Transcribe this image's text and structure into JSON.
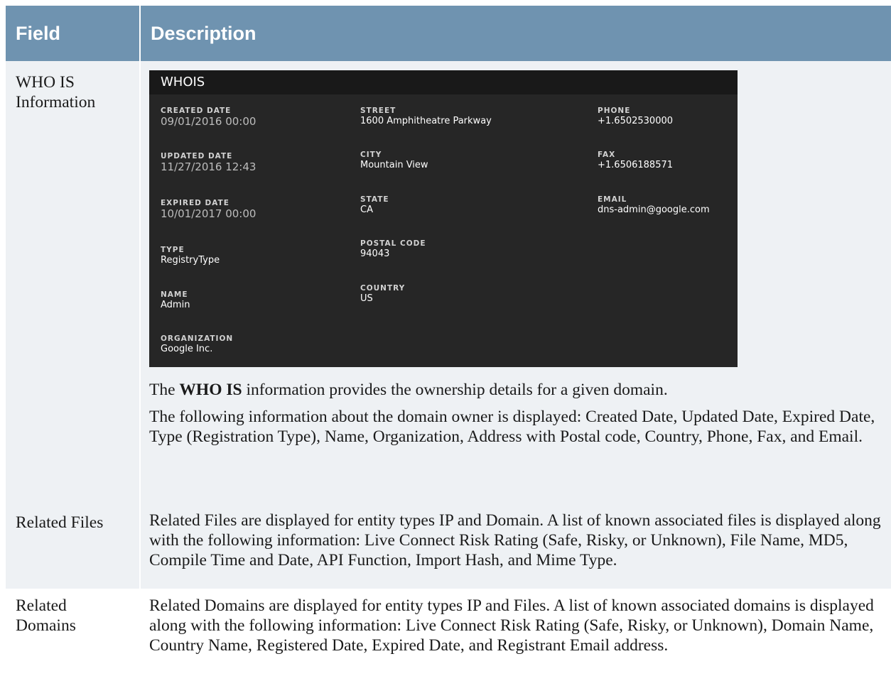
{
  "header": {
    "field": "Field",
    "description": "Description"
  },
  "rows": [
    {
      "field": "WHO IS Information",
      "whois": {
        "title": "WHOIS",
        "col1": [
          {
            "label": "CREATED DATE",
            "value": "09/01/2016 00:00"
          },
          {
            "label": "UPDATED DATE",
            "value": "11/27/2016 12:43"
          },
          {
            "label": "EXPIRED DATE",
            "value": "10/01/2017 00:00"
          },
          {
            "label": "TYPE",
            "value": "RegistryType"
          },
          {
            "label": "NAME",
            "value": "Admin"
          },
          {
            "label": "ORGANIZATION",
            "value": "Google Inc."
          }
        ],
        "col2": [
          {
            "label": "STREET",
            "value": "1600 Amphitheatre Parkway"
          },
          {
            "label": "CITY",
            "value": "Mountain View"
          },
          {
            "label": "STATE",
            "value": "CA"
          },
          {
            "label": "POSTAL CODE",
            "value": "94043"
          },
          {
            "label": "COUNTRY",
            "value": "US"
          }
        ],
        "col3": [
          {
            "label": "PHONE",
            "value": "+1.6502530000"
          },
          {
            "label": "FAX",
            "value": "+1.6506188571"
          },
          {
            "label": "EMAIL",
            "value": "dns-admin@google.com"
          }
        ]
      },
      "para1_pre": "The ",
      "para1_bold": "WHO IS",
      "para1_post": " information provides the ownership details for a given domain.",
      "para2": "The following information about the domain owner is displayed: Created Date, Updated Date, Expired Date, Type (Registration Type), Name, Organization, Address with Postal code, Country, Phone, Fax, and Email."
    },
    {
      "field": "Related Files",
      "description": "Related Files are displayed for entity types IP and Domain. A list of known associated files is displayed along with the following information: Live Connect Risk Rating (Safe, Risky, or Unknown), File Name, MD5, Compile Time and Date, API Function, Import Hash, and Mime Type."
    },
    {
      "field": "Related Domains",
      "description": "Related Domains are displayed for entity types IP and Files. A list of known associated domains is displayed along with the following information: Live Connect Risk Rating (Safe, Risky, or Unknown), Domain Name, Country Name, Registered Date, Expired Date, and Registrant Email address."
    }
  ]
}
